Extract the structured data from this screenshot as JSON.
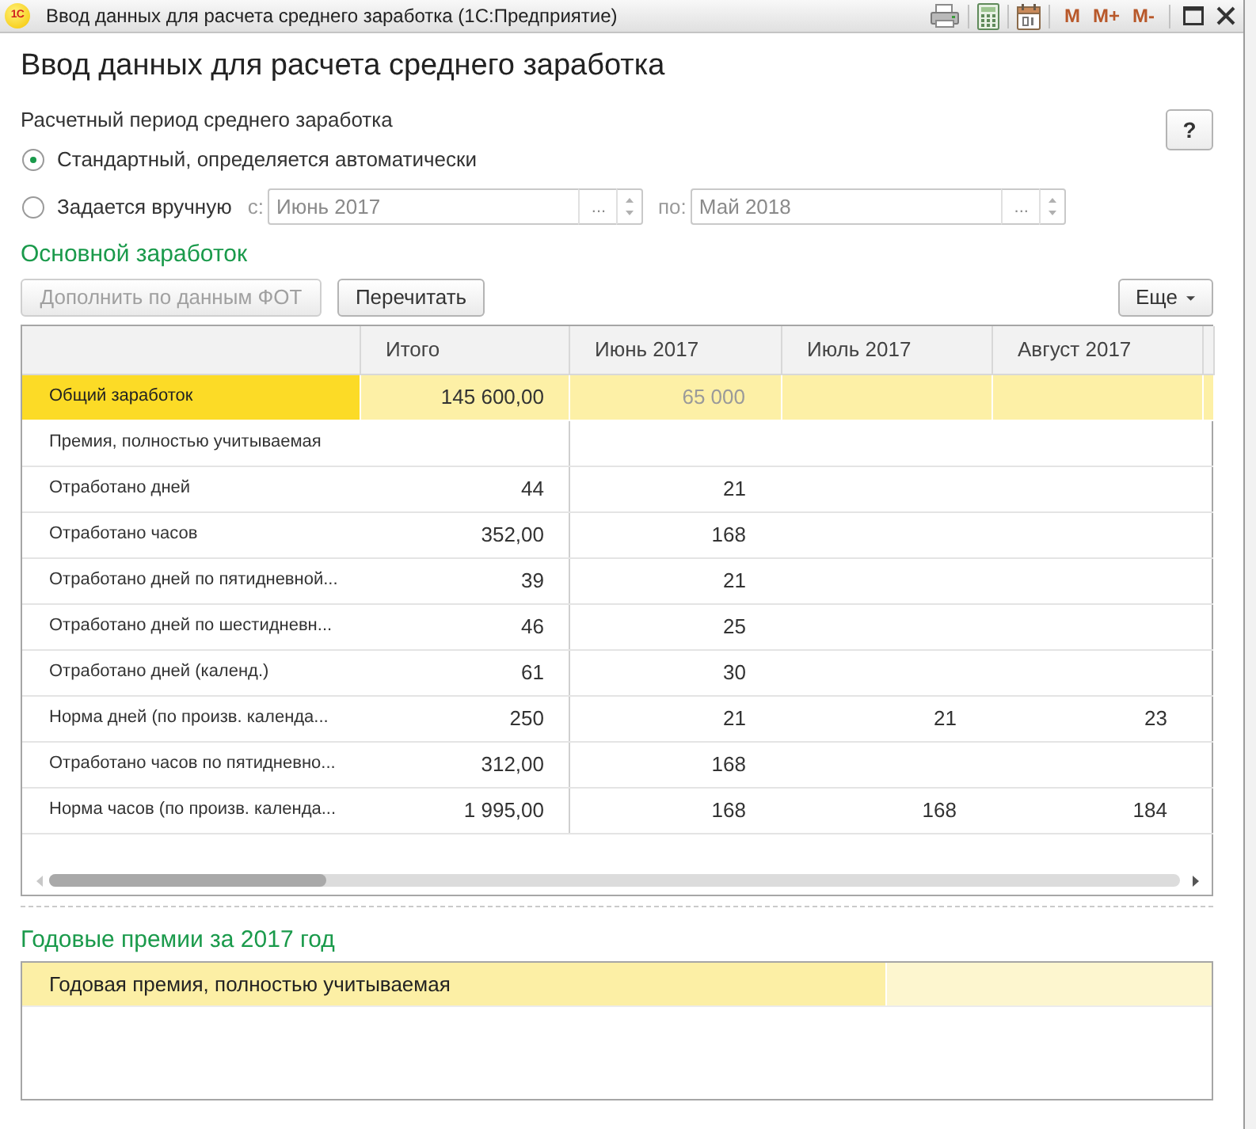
{
  "window": {
    "logo": "1С",
    "title": "Ввод данных для расчета среднего заработка (1С:Предприятие)",
    "memory_buttons": [
      "M",
      "M+",
      "M-"
    ]
  },
  "heading": "Ввод данных для расчета среднего заработка",
  "period": {
    "label": "Расчетный период среднего заработка",
    "help_button": "?",
    "options": [
      {
        "label": "Стандартный, определяется автоматически",
        "selected": true
      },
      {
        "label": "Задается вручную",
        "selected": false
      }
    ],
    "fields": [
      {
        "label": "с:",
        "value": "Июнь 2017",
        "choice_button": "...",
        "disabled": true
      },
      {
        "label": "по:",
        "value": "Май 2018",
        "choice_button": "...",
        "disabled": true
      }
    ]
  },
  "main_earnings": {
    "title": "Основной заработок",
    "buttons": [
      {
        "label": "Дополнить по данным ФОТ",
        "disabled": true
      },
      {
        "label": "Перечитать",
        "disabled": false
      }
    ],
    "more_button": "Еще",
    "table": {
      "columns": [
        "Итого",
        "Июнь 2017",
        "Июль 2017",
        "Август 2017"
      ],
      "rows": [
        {
          "kind": "total",
          "label": "Общий заработок",
          "cells": [
            {
              "text": "145 600,00",
              "dimmed": false
            },
            {
              "text": "65 000",
              "dimmed": true
            }
          ]
        },
        {
          "kind": "plain",
          "label": "Премия, полностью учитываемая"
        },
        {
          "kind": "plain",
          "label": "Отработано дней",
          "cells": [
            {
              "text": "44",
              "dimmed": false
            },
            {
              "text": "21",
              "dimmed": false
            }
          ]
        },
        {
          "kind": "plain",
          "label": "Отработано часов",
          "cells": [
            {
              "text": "352,00",
              "dimmed": false
            },
            {
              "text": "168",
              "dimmed": false
            }
          ]
        },
        {
          "kind": "plain",
          "label": "Отработано дней по пятидневной...",
          "cells": [
            {
              "text": "39",
              "dimmed": false
            },
            {
              "text": "21",
              "dimmed": false
            }
          ]
        },
        {
          "kind": "plain",
          "label": "Отработано дней по шестидневн...",
          "cells": [
            {
              "text": "46",
              "dimmed": false
            },
            {
              "text": "25",
              "dimmed": false
            }
          ]
        },
        {
          "kind": "plain",
          "label": "Отработано дней (календ.)",
          "cells": [
            {
              "text": "61",
              "dimmed": false
            },
            {
              "text": "30",
              "dimmed": false
            }
          ]
        },
        {
          "kind": "plain",
          "label": "Норма дней (по произв. календа...",
          "cells": [
            {
              "text": "250",
              "dimmed": false
            },
            {
              "text": "21",
              "dimmed": false
            },
            {
              "text": "21",
              "dimmed": false
            },
            {
              "text": "23",
              "dimmed": false
            }
          ]
        },
        {
          "kind": "plain",
          "label": "Отработано часов по пятидневно...",
          "cells": [
            {
              "text": "312,00",
              "dimmed": false
            },
            {
              "text": "168",
              "dimmed": false
            }
          ]
        },
        {
          "kind": "plain",
          "label": "Норма часов (по произв. календа...",
          "cells": [
            {
              "text": "1 995,00",
              "dimmed": false
            },
            {
              "text": "168",
              "dimmed": false
            },
            {
              "text": "168",
              "dimmed": false
            },
            {
              "text": "184",
              "dimmed": false
            }
          ]
        }
      ]
    }
  },
  "annual_bonuses": {
    "title": "Годовые премии за 2017 год",
    "rows": [
      {
        "label": "Годовая премия, полностью учитываемая"
      }
    ]
  }
}
